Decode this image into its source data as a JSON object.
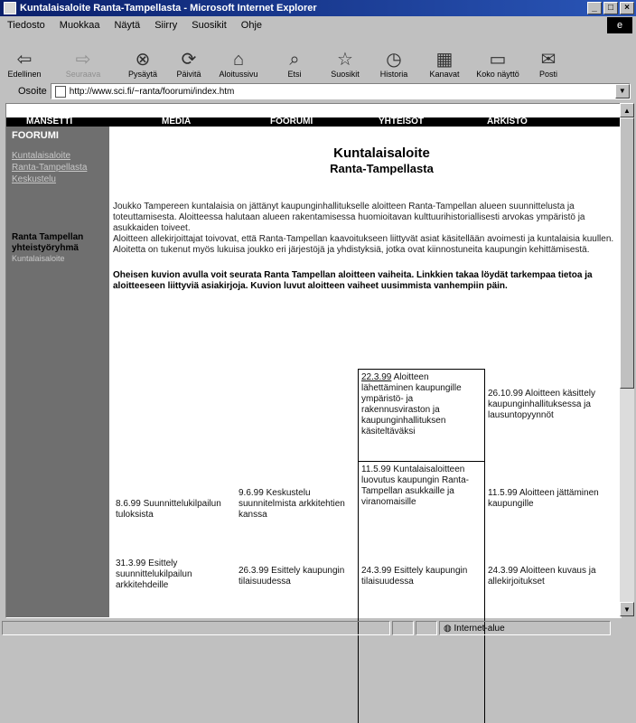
{
  "window": {
    "title": "Kuntalaisaloite Ranta-Tampellasta - Microsoft Internet Explorer",
    "controls": {
      "minimize": "_",
      "maximize": "□",
      "close": "×"
    }
  },
  "menu": [
    "Tiedosto",
    "Muokkaa",
    "Näytä",
    "Siirry",
    "Suosikit",
    "Ohje"
  ],
  "toolbar": [
    {
      "label": "Edellinen",
      "icon": "back-arrow-icon",
      "glyph": "⇦"
    },
    {
      "label": "Seuraava",
      "icon": "forward-arrow-icon",
      "glyph": "⇨"
    },
    {
      "label": "Pysäytä",
      "icon": "stop-icon",
      "glyph": "⊗"
    },
    {
      "label": "Päivitä",
      "icon": "refresh-icon",
      "glyph": "⟳"
    },
    {
      "label": "Aloitussivu",
      "icon": "home-icon",
      "glyph": "⌂"
    },
    {
      "label": "Etsi",
      "icon": "search-icon",
      "glyph": "⌕"
    },
    {
      "label": "Suosikit",
      "icon": "favorites-icon",
      "glyph": "☆"
    },
    {
      "label": "Historia",
      "icon": "history-icon",
      "glyph": "◷"
    },
    {
      "label": "Kanavat",
      "icon": "channels-icon",
      "glyph": "▦"
    },
    {
      "label": "Koko näyttö",
      "icon": "fullscreen-icon",
      "glyph": "▭"
    },
    {
      "label": "Posti",
      "icon": "mail-icon",
      "glyph": "✉"
    }
  ],
  "address": {
    "label": "Osoite",
    "url": "http://www.sci.fi/~ranta/foorumi/index.htm"
  },
  "nav": [
    "MANSETTI",
    "MEDIA",
    "FOORUMI",
    "YHTEISÖT",
    "ARKISTO"
  ],
  "sidebar": {
    "section": "FOORUMI",
    "links": [
      "Kuntalaisaloite",
      "Ranta-Tampellasta",
      "Keskustelu"
    ],
    "org_title": "Ranta Tampellan yhteistyöryhmä",
    "org_link": "Kuntalaisaloite"
  },
  "heading": {
    "title": "Kuntalaisaloite",
    "subtitle": "Ranta-Tampellasta"
  },
  "intro": [
    "Joukko Tampereen kuntalaisia on jättänyt kaupunginhallitukselle aloitteen Ranta-Tampellan alueen suunnittelusta ja toteuttamisesta. Aloitteessa halutaan alueen rakentamisessa huomioitavan kulttuurihistoriallisesti arvokas ympäristö ja asukkaiden toiveet.",
    "Aloitteen allekirjoittajat toivovat, että Ranta-Tampellan kaavoitukseen liittyvät asiat käsitellään avoimesti ja kuntalaisia kuullen. Aloitetta on tukenut myös lukuisa joukko eri järjestöjä ja yhdistyksiä, jotka ovat kiinnostuneita kaupungin kehittämisestä."
  ],
  "note": "Oheisen kuvion avulla voit seurata Ranta Tampellan aloitteen vaiheita. Linkkien takaa löydät tarkempaa tietoa ja aloitteeseen liittyviä asiakirjoja. Kuvion luvut aloitteen vaiheet uusimmista vanhempiin päin.",
  "timeline": [
    {
      "date": "22.3.99",
      "text": "Aloitteen lähettäminen kaupungille ympäristö- ja rakennusviraston ja kaupunginhallituksen käsiteltäväksi"
    },
    {
      "date": "26.10.99",
      "text": "Aloitteen käsittely kaupunginhallituksessa ja lausuntopyynnöt"
    },
    {
      "date": "11.5.99",
      "text": "Kuntalaisaloitteen luovutus kaupungin Ranta-Tampellan asukkaille ja viranomaisille"
    },
    {
      "date": "8.6.99",
      "text": "Suunnittelukilpailun tuloksista"
    },
    {
      "date": "9.6.99",
      "text": "Keskustelu suunnitelmista arkkitehtien kanssa"
    },
    {
      "date": "11.5.99",
      "text": "Aloitteen jättäminen kaupungille"
    },
    {
      "date": "31.3.99",
      "text": "Esittely suunnittelukilpailun arkkitehdeille"
    },
    {
      "date": "26.3.99",
      "text": "Esittely kaupungin tilaisuudessa"
    },
    {
      "date": "24.3.99",
      "text": "Esittely kaupungin tilaisuudessa"
    },
    {
      "date": "24.3.99",
      "text": "Aloitteen kuvaus ja allekirjoitukset"
    }
  ],
  "status": {
    "left": "",
    "zone": "Internet-alue"
  }
}
